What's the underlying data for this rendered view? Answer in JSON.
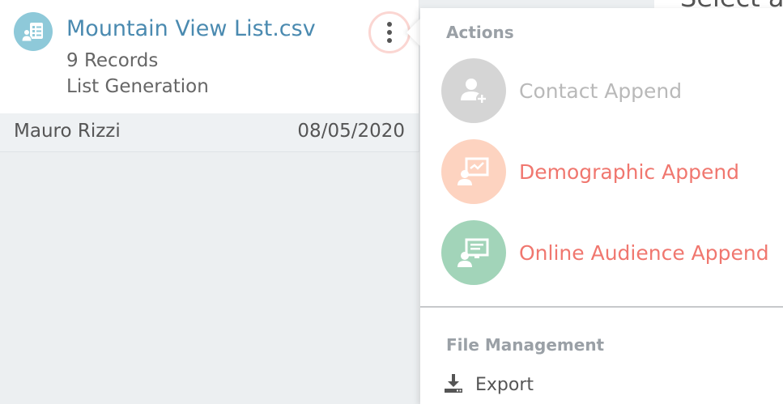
{
  "background": {
    "title": "Select a"
  },
  "file_card": {
    "icon": "list-file-icon",
    "title": "Mountain View List.csv",
    "records": "9 Records",
    "type": "List Generation",
    "menu_icon": "kebab-menu-icon",
    "owner": "Mauro Rizzi",
    "date": "08/05/2020"
  },
  "menu": {
    "actions_heading": "Actions",
    "actions": [
      {
        "label": "Contact Append",
        "icon": "add-contact-icon",
        "enabled": false,
        "icon_bg": "#d5d5d5",
        "label_color": "#b9b9b9"
      },
      {
        "label": "Demographic Append",
        "icon": "demographic-chart-icon",
        "enabled": true,
        "icon_bg": "#fdd3c0",
        "label_color": "#f0776f"
      },
      {
        "label": "Online Audience Append",
        "icon": "online-audience-icon",
        "enabled": true,
        "icon_bg": "#a2d4b9",
        "label_color": "#f0776f"
      }
    ],
    "file_heading": "File Management",
    "file_items": [
      {
        "label": "Export",
        "icon": "download-icon"
      }
    ]
  },
  "colors": {
    "accent_title": "#4a8ab0",
    "kebab_ring": "#fbd6d2",
    "card_icon_bg": "#8ec9d9"
  }
}
